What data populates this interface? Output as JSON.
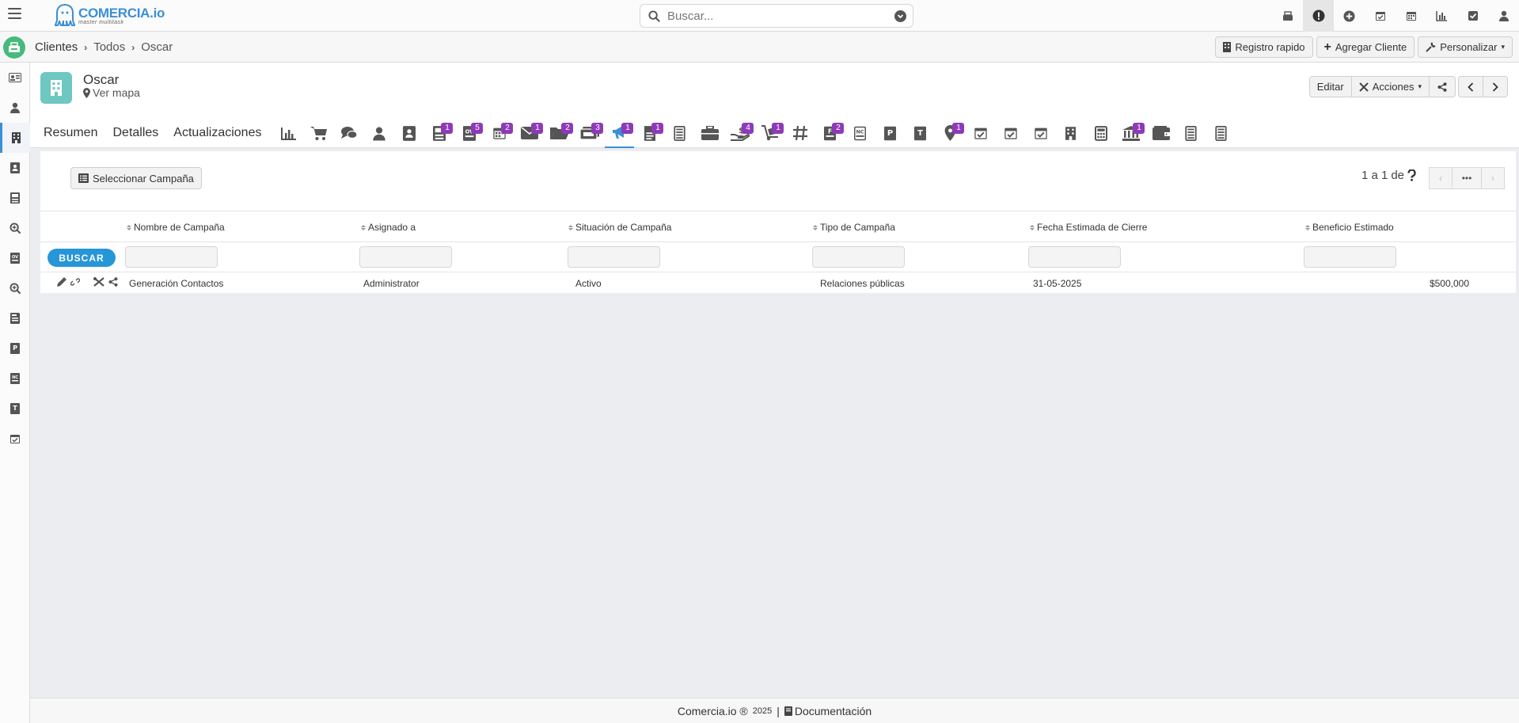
{
  "app": {
    "brand": "COMERCIA.io",
    "tagline": "master multitask"
  },
  "search": {
    "placeholder": "Buscar..."
  },
  "top_icons": [
    "register-icon",
    "alert-icon",
    "plus-circle-icon",
    "calendar-check-icon",
    "calendar-icon",
    "bar-chart-icon",
    "task-check-icon",
    "user-icon"
  ],
  "breadcrumb": {
    "items": [
      "Clientes",
      "Todos",
      "Oscar"
    ]
  },
  "crumb_buttons": {
    "quick_register": "Registro rapido",
    "add_client": "Agregar Cliente",
    "customize": "Personalizar"
  },
  "record": {
    "name": "Oscar",
    "map_link": "Ver mapa",
    "edit": "Editar",
    "actions": "Acciones"
  },
  "tabs": {
    "text": [
      "Resumen",
      "Detalles",
      "Actualizaciones"
    ],
    "badges": {
      "quotes": "1",
      "orders": "5",
      "calendar": "2",
      "emails": "1",
      "folders": "2",
      "cards": "3",
      "campaigns": "1",
      "docs": "1",
      "payments": "4",
      "delivery": "1",
      "invoices": "2",
      "location": "1",
      "bank": "1"
    }
  },
  "panel": {
    "select_button": "Seleccionar Campaña",
    "pager_text": "1 a 1",
    "pager_of": "de"
  },
  "table": {
    "headers": [
      "Nombre de Campaña",
      "Asignado a",
      "Situación de Campaña",
      "Tipo de Campaña",
      "Fecha Estimada de Cierre",
      "Beneficio Estimado"
    ],
    "search_button": "BUSCAR",
    "rows": [
      [
        "Generación Contactos",
        "Administrator",
        "Activo",
        "Relaciones públicas",
        "31-05-2025",
        "$500,000"
      ]
    ]
  },
  "footer": {
    "text": "Comercia.io ®",
    "year": "2025",
    "separator": "|",
    "docs": "Documentación"
  },
  "colors": {
    "accent": "#3a8fd6",
    "badge": "#8e3ab8",
    "home": "#47b97c",
    "avatar": "#6ec7c1",
    "buscar": "#2796d8"
  }
}
